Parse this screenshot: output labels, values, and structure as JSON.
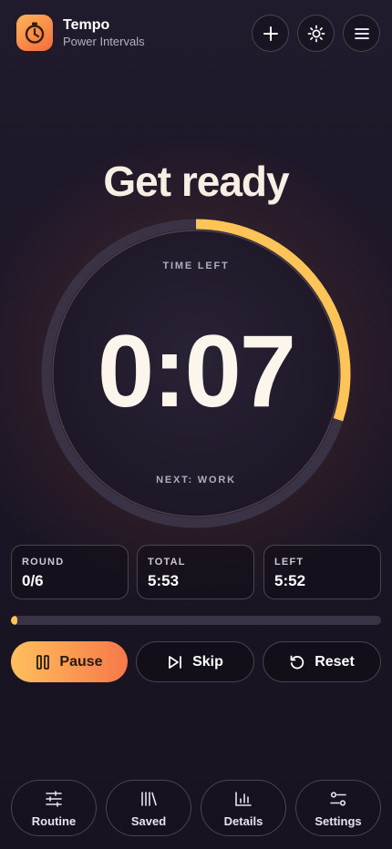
{
  "app": {
    "title": "Tempo",
    "subtitle": "Power Intervals"
  },
  "header_buttons": [
    {
      "name": "add-button",
      "icon": "plus-icon"
    },
    {
      "name": "theme-button",
      "icon": "sun-icon"
    },
    {
      "name": "menu-button",
      "icon": "hamburger-icon"
    }
  ],
  "timer": {
    "phase": "Get ready",
    "time_left_label": "TIME LEFT",
    "time_left": "0:07",
    "next_label": "NEXT: WORK",
    "ring_progress": 0.3
  },
  "stats": [
    {
      "label": "ROUND",
      "value": "0/6"
    },
    {
      "label": "TOTAL",
      "value": "5:53"
    },
    {
      "label": "LEFT",
      "value": "5:52"
    }
  ],
  "progress": {
    "fraction": 0.003
  },
  "controls": {
    "pause_label": "Pause",
    "skip_label": "Skip",
    "reset_label": "Reset"
  },
  "nav": [
    {
      "label": "Routine",
      "icon": "sliders-icon"
    },
    {
      "label": "Saved",
      "icon": "library-icon"
    },
    {
      "label": "Details",
      "icon": "bar-chart-icon"
    },
    {
      "label": "Settings",
      "icon": "settings-icon"
    }
  ],
  "colors": {
    "accent": "#ffc457",
    "accent_gradient_end": "#f6784a",
    "background": "#1c1627",
    "ring_track": "#3a3346"
  }
}
